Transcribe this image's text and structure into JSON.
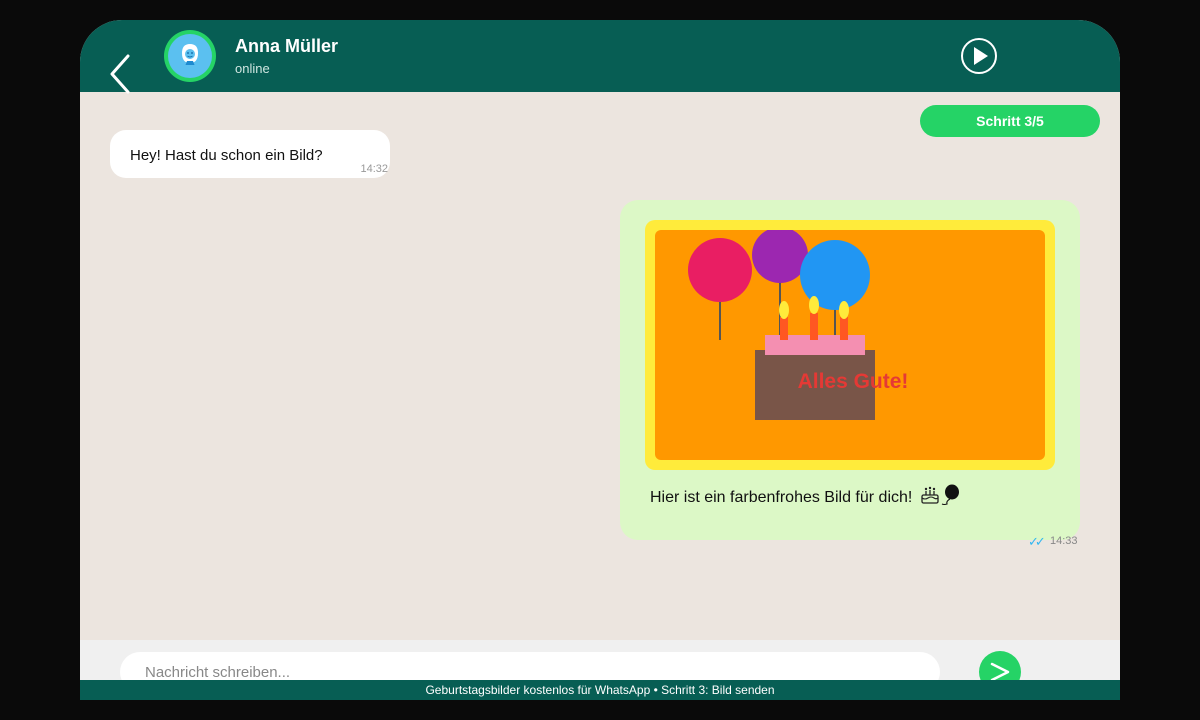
{
  "header": {
    "contact_name": "Anna Müller",
    "contact_status": "online",
    "back_icon": "chevron-left-icon",
    "play_icon": "play-circle-icon"
  },
  "progress": {
    "label": "Schritt 3/5",
    "current_step": 3,
    "total_steps": 5
  },
  "messages": [
    {
      "direction": "incoming",
      "text": "Hey! Hast du schon ein Bild?",
      "time": "14:32"
    },
    {
      "direction": "outgoing",
      "image_text": "Alles Gute!",
      "caption": "Hier ist ein farbenfrohes Bild für dich!",
      "caption_emojis": [
        "birthday-cake-icon",
        "balloon-icon"
      ],
      "ticks": "✓✓",
      "time": "14:33"
    }
  ],
  "composer": {
    "placeholder": "Nachricht schreiben...",
    "send_icon": "send-icon"
  },
  "footer": {
    "text": "Geburtstagsbilder kostenlos für WhatsApp • Schritt 3: Bild senden"
  },
  "colors": {
    "header": "#075e54",
    "accent": "#25d366",
    "chat_background": "#ece5df",
    "outgoing_bubble": "#dcf8c6",
    "incoming_bubble": "#ffffff",
    "read_ticks": "#34b7f1"
  }
}
